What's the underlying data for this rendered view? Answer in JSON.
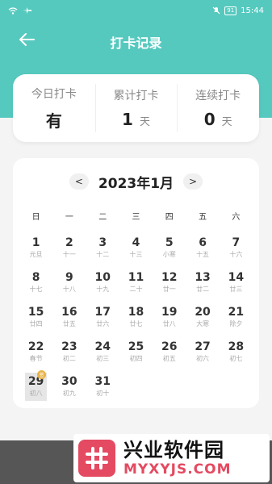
{
  "status_bar": {
    "battery": "91",
    "time": "15:44",
    "icons": [
      "wifi-icon",
      "airplane-icon",
      "mute-icon",
      "battery-icon"
    ]
  },
  "header": {
    "title": "打卡记录",
    "back_icon": "back-arrow-icon",
    "color": "#56c9bf"
  },
  "stats": [
    {
      "label": "今日打卡",
      "value": "有",
      "unit": ""
    },
    {
      "label": "累计打卡",
      "value": "1",
      "unit": "天"
    },
    {
      "label": "连续打卡",
      "value": "0",
      "unit": "天"
    }
  ],
  "calendar": {
    "title": "2023年1月",
    "prev": "<",
    "next": ">",
    "weekdays": [
      "日",
      "一",
      "二",
      "三",
      "四",
      "五",
      "六"
    ],
    "days": [
      {
        "num": "1",
        "lunar": "元旦"
      },
      {
        "num": "2",
        "lunar": "十一"
      },
      {
        "num": "3",
        "lunar": "十二"
      },
      {
        "num": "4",
        "lunar": "十三"
      },
      {
        "num": "5",
        "lunar": "小寒"
      },
      {
        "num": "6",
        "lunar": "十五"
      },
      {
        "num": "7",
        "lunar": "十六"
      },
      {
        "num": "8",
        "lunar": "十七"
      },
      {
        "num": "9",
        "lunar": "十八"
      },
      {
        "num": "10",
        "lunar": "十九"
      },
      {
        "num": "11",
        "lunar": "二十"
      },
      {
        "num": "12",
        "lunar": "廿一"
      },
      {
        "num": "13",
        "lunar": "廿二"
      },
      {
        "num": "14",
        "lunar": "廿三"
      },
      {
        "num": "15",
        "lunar": "廿四"
      },
      {
        "num": "16",
        "lunar": "廿五"
      },
      {
        "num": "17",
        "lunar": "廿六"
      },
      {
        "num": "18",
        "lunar": "廿七"
      },
      {
        "num": "19",
        "lunar": "廿八"
      },
      {
        "num": "20",
        "lunar": "大寒"
      },
      {
        "num": "21",
        "lunar": "除夕"
      },
      {
        "num": "22",
        "lunar": "春节"
      },
      {
        "num": "23",
        "lunar": "初二"
      },
      {
        "num": "24",
        "lunar": "初三"
      },
      {
        "num": "25",
        "lunar": "初四"
      },
      {
        "num": "26",
        "lunar": "初五"
      },
      {
        "num": "27",
        "lunar": "初六"
      },
      {
        "num": "28",
        "lunar": "初七"
      },
      {
        "num": "29",
        "lunar": "初八",
        "today": true,
        "badge": "签"
      },
      {
        "num": "30",
        "lunar": "初九"
      },
      {
        "num": "31",
        "lunar": "初十"
      }
    ]
  },
  "watermark": {
    "title": "兴业软件园",
    "url": "MYXYJS.COM",
    "logo_icon": "hash-logo-icon"
  }
}
